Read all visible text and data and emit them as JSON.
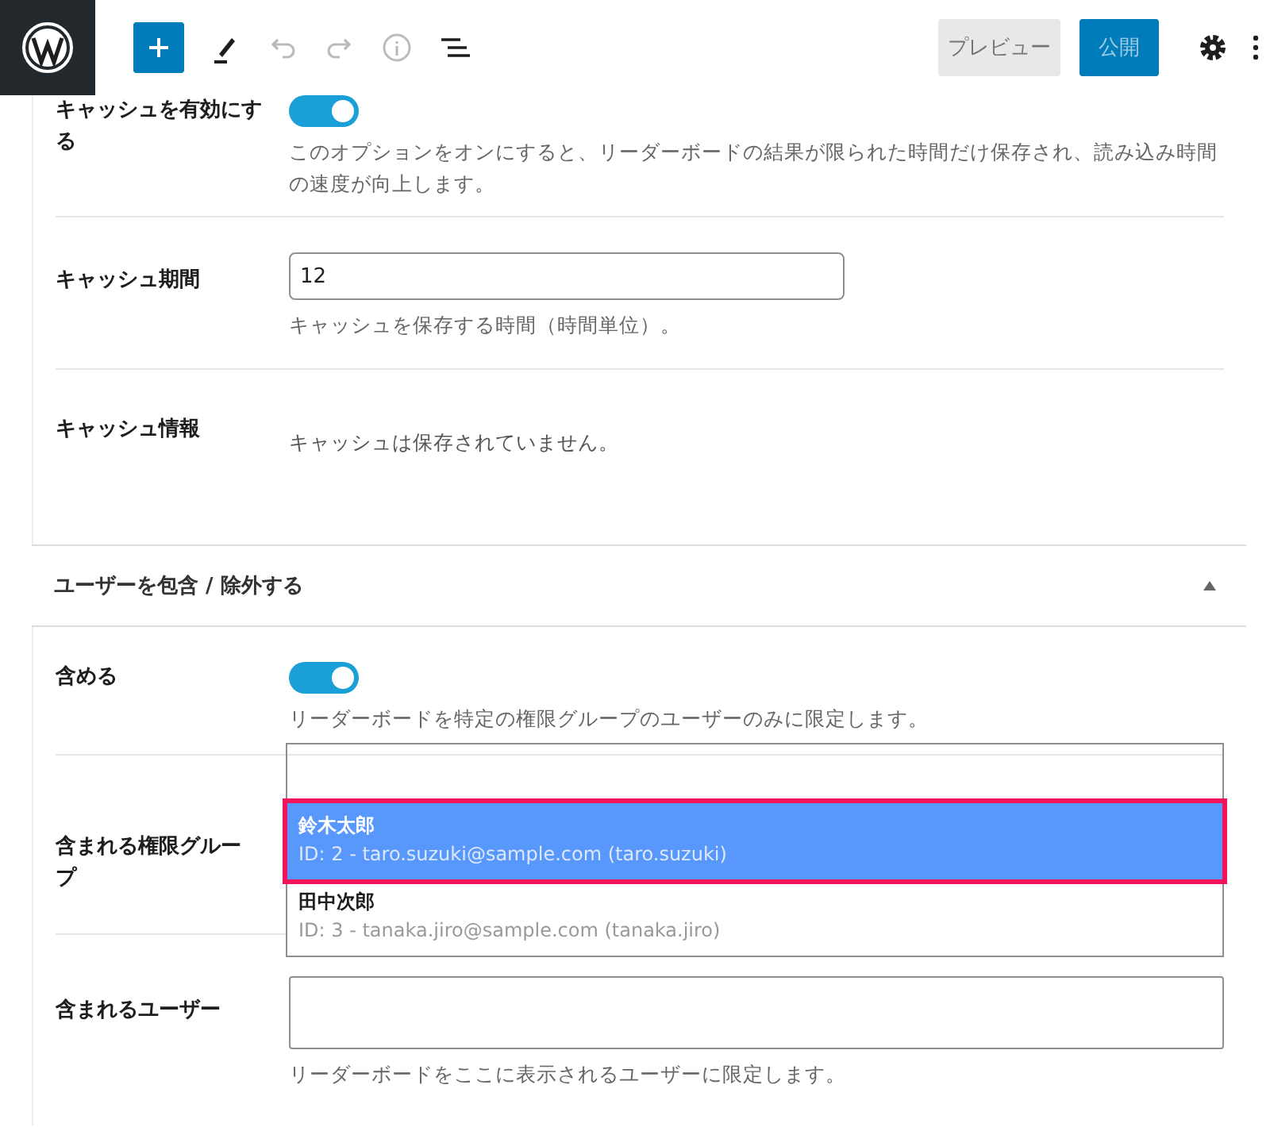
{
  "toolbar": {
    "preview": "プレビュー",
    "publish": "公開"
  },
  "cache_rows": [
    {
      "kind": "toggle",
      "label": "キャッシュを有効にする",
      "on": true,
      "help": "このオプションをオンにすると、リーダーボードの結果が限られた時間だけ保存され、読み込み時間の速度が向上します。"
    },
    {
      "kind": "input",
      "label": "キャッシュ期間",
      "value": "12",
      "help": "キャッシュを保存する時間（時間単位）。"
    },
    {
      "kind": "info",
      "label": "キャッシュ情報",
      "text": "キャッシュは保存されていません。"
    }
  ],
  "section": {
    "title": "ユーザーを包含 / 除外する",
    "expanded": true
  },
  "include_rows": [
    {
      "kind": "toggle",
      "label": "含める",
      "on": true,
      "help": "リーダーボードを特定の権限グループのユーザーのみに限定します。"
    },
    {
      "kind": "select",
      "label": "含まれる権限グループ",
      "options": [
        {
          "name": "鈴木太郎",
          "detail": "ID: 2 - taro.suzuki@sample.com (taro.suzuki)",
          "selected": true,
          "annotated": true
        },
        {
          "name": "田中次郎",
          "detail": "ID: 3 - tanaka.jiro@sample.com (tanaka.jiro)",
          "selected": false,
          "annotated": false
        }
      ]
    },
    {
      "kind": "input",
      "label": "含まれるユーザー",
      "value": "",
      "help": "リーダーボードをここに表示されるユーザーに限定します。"
    }
  ]
}
